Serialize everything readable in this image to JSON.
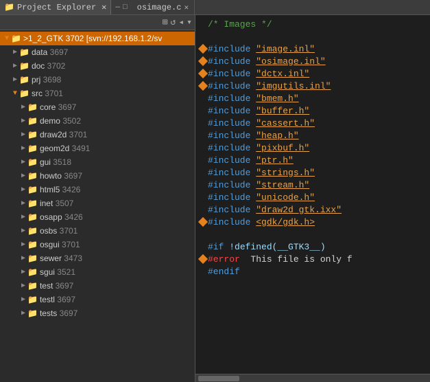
{
  "titlebar": {
    "left_title": "Project Explorer",
    "left_close": "✕",
    "right_tab": "osimage.c",
    "right_close": "✕",
    "minimize": "—",
    "maximize": "□",
    "expand": "▽"
  },
  "toolbar": {
    "icon1": "⊞",
    "icon2": "↺",
    "icon3": "◂",
    "icon4": "▾"
  },
  "tree": {
    "root": ">1_2_GTK 3702 [svn://192.168.1.2/sv",
    "items": [
      {
        "indent": 1,
        "arrow": "▶",
        "name": "data",
        "rev": " 3697"
      },
      {
        "indent": 1,
        "arrow": "▶",
        "name": "doc",
        "rev": " 3702"
      },
      {
        "indent": 1,
        "arrow": "▶",
        "name": "prj",
        "rev": " 3698"
      },
      {
        "indent": 1,
        "arrow": "▼",
        "name": "src",
        "rev": " 3701"
      },
      {
        "indent": 2,
        "arrow": "▶",
        "name": "core",
        "rev": " 3697"
      },
      {
        "indent": 2,
        "arrow": "▶",
        "name": "demo",
        "rev": " 3502"
      },
      {
        "indent": 2,
        "arrow": "▶",
        "name": "draw2d",
        "rev": " 3701"
      },
      {
        "indent": 2,
        "arrow": "▶",
        "name": "geom2d",
        "rev": " 3491"
      },
      {
        "indent": 2,
        "arrow": "▶",
        "name": "gui",
        "rev": " 3518"
      },
      {
        "indent": 2,
        "arrow": "▶",
        "name": "howto",
        "rev": " 3697"
      },
      {
        "indent": 2,
        "arrow": "▶",
        "name": "html5",
        "rev": " 3426"
      },
      {
        "indent": 2,
        "arrow": "▶",
        "name": "inet",
        "rev": " 3507"
      },
      {
        "indent": 2,
        "arrow": "▶",
        "name": "osapp",
        "rev": " 3426"
      },
      {
        "indent": 2,
        "arrow": "▶",
        "name": "osbs",
        "rev": " 3701"
      },
      {
        "indent": 2,
        "arrow": "▶",
        "name": "osgui",
        "rev": " 3701"
      },
      {
        "indent": 2,
        "arrow": "▶",
        "name": "sewer",
        "rev": " 3473"
      },
      {
        "indent": 2,
        "arrow": "▶",
        "name": "sgui",
        "rev": " 3521"
      },
      {
        "indent": 2,
        "arrow": "▶",
        "name": "test",
        "rev": " 3697"
      },
      {
        "indent": 2,
        "arrow": "▶",
        "name": "testl",
        "rev": " 3697"
      },
      {
        "indent": 2,
        "arrow": "▶",
        "name": "tests",
        "rev": " 3697"
      }
    ]
  },
  "code": {
    "filename": "osimage.c",
    "lines": [
      {
        "marker": false,
        "content": "/* Images */",
        "type": "comment"
      },
      {
        "marker": false,
        "content": "",
        "type": "blank"
      },
      {
        "marker": true,
        "content": "#include \"image.inl\"",
        "type": "include"
      },
      {
        "marker": true,
        "content": "#include \"osimage.inl\"",
        "type": "include"
      },
      {
        "marker": true,
        "content": "#include \"dctx.inl\"",
        "type": "include"
      },
      {
        "marker": true,
        "content": "#include \"imgutils.inl\"",
        "type": "include"
      },
      {
        "marker": false,
        "content": "#include \"bmem.h\"",
        "type": "include"
      },
      {
        "marker": false,
        "content": "#include \"buffer.h\"",
        "type": "include"
      },
      {
        "marker": false,
        "content": "#include \"cassert.h\"",
        "type": "include"
      },
      {
        "marker": false,
        "content": "#include \"heap.h\"",
        "type": "include"
      },
      {
        "marker": false,
        "content": "#include \"pixbuf.h\"",
        "type": "include"
      },
      {
        "marker": false,
        "content": "#include \"ptr.h\"",
        "type": "include"
      },
      {
        "marker": false,
        "content": "#include \"strings.h\"",
        "type": "include"
      },
      {
        "marker": false,
        "content": "#include \"stream.h\"",
        "type": "include"
      },
      {
        "marker": false,
        "content": "#include \"unicode.h\"",
        "type": "include"
      },
      {
        "marker": false,
        "content": "#include \"draw2d_gtk.ixx\"",
        "type": "include"
      },
      {
        "marker": true,
        "content": "#include <gdk/gdk.h>",
        "type": "include_angle"
      },
      {
        "marker": false,
        "content": "",
        "type": "blank"
      },
      {
        "marker": false,
        "content": "#if !defined(__GTK3__)",
        "type": "prep"
      },
      {
        "marker": true,
        "content": "#error  This file is only f",
        "type": "error"
      },
      {
        "marker": false,
        "content": "#endif",
        "type": "prep"
      }
    ]
  }
}
